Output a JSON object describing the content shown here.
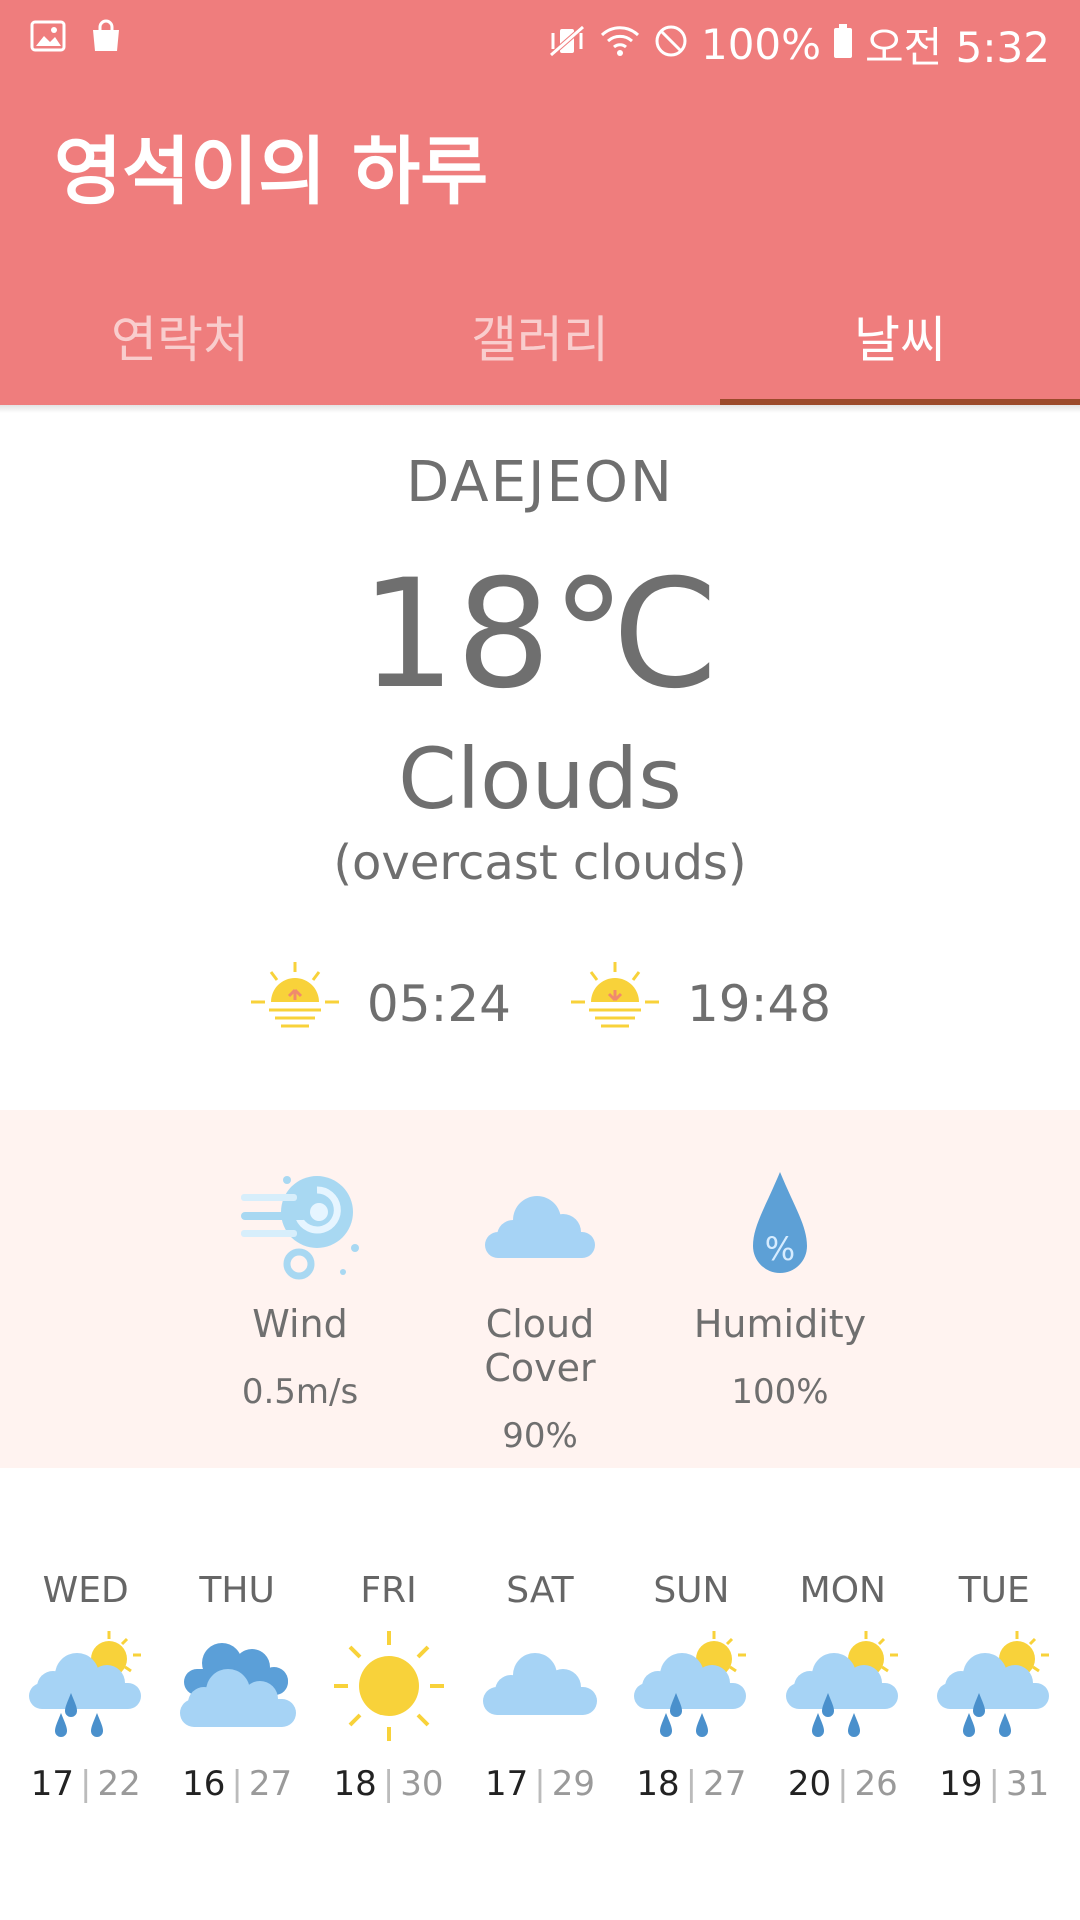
{
  "status": {
    "battery": "100%",
    "time": "오전 5:32"
  },
  "app": {
    "title": "영석이의 하루"
  },
  "tabs": [
    {
      "label": "연락처"
    },
    {
      "label": "갤러리"
    },
    {
      "label": "날씨",
      "active": true
    }
  ],
  "weather": {
    "city": "DAEJEON",
    "temperature": "18℃",
    "condition": "Clouds",
    "description": "(overcast clouds)",
    "sunrise": "05:24",
    "sunset": "19:48"
  },
  "details": [
    {
      "icon": "wind-icon",
      "label": "Wind",
      "value": "0.5m/s"
    },
    {
      "icon": "cloud-icon",
      "label": "Cloud Cover",
      "value": "90%"
    },
    {
      "icon": "humidity-drop-icon",
      "label": "Humidity",
      "value": "100%"
    }
  ],
  "forecast": [
    {
      "day": "WED",
      "icon": "rain-sun",
      "min": "17",
      "max": "22"
    },
    {
      "day": "THU",
      "icon": "clouds",
      "min": "16",
      "max": "27"
    },
    {
      "day": "FRI",
      "icon": "sun",
      "min": "18",
      "max": "30"
    },
    {
      "day": "SAT",
      "icon": "cloud",
      "min": "17",
      "max": "29"
    },
    {
      "day": "SUN",
      "icon": "rain-sun",
      "min": "18",
      "max": "27"
    },
    {
      "day": "MON",
      "icon": "rain-sun",
      "min": "20",
      "max": "26"
    },
    {
      "day": "TUE",
      "icon": "rain-sun",
      "min": "19",
      "max": "31"
    }
  ],
  "colors": {
    "topbar": "#ef7d7d",
    "tab_indicator": "#9b4a2b",
    "details_bg": "#fff3f0"
  }
}
